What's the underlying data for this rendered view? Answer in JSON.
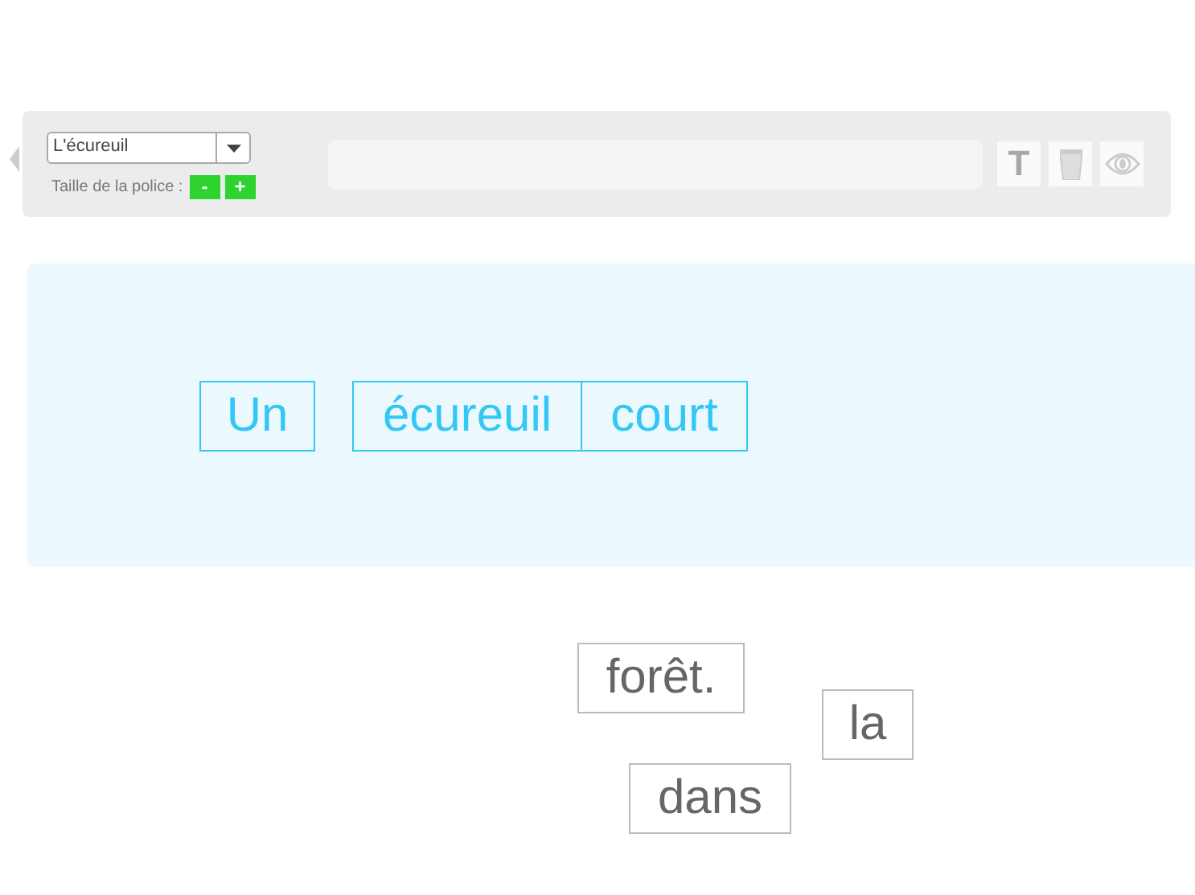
{
  "toolbar": {
    "sentence_select": {
      "value": "L'écureuil"
    },
    "font_size_label": "Taille de la police :",
    "font_buttons": [
      "-",
      "+"
    ],
    "text_tool": "T"
  },
  "sentence_area": {
    "words": [
      {
        "text": "Un"
      },
      {
        "text": "écureuil"
      },
      {
        "text": "court"
      }
    ]
  },
  "loose_words": [
    {
      "text": "forêt."
    },
    {
      "text": "la"
    },
    {
      "text": "dans"
    }
  ]
}
